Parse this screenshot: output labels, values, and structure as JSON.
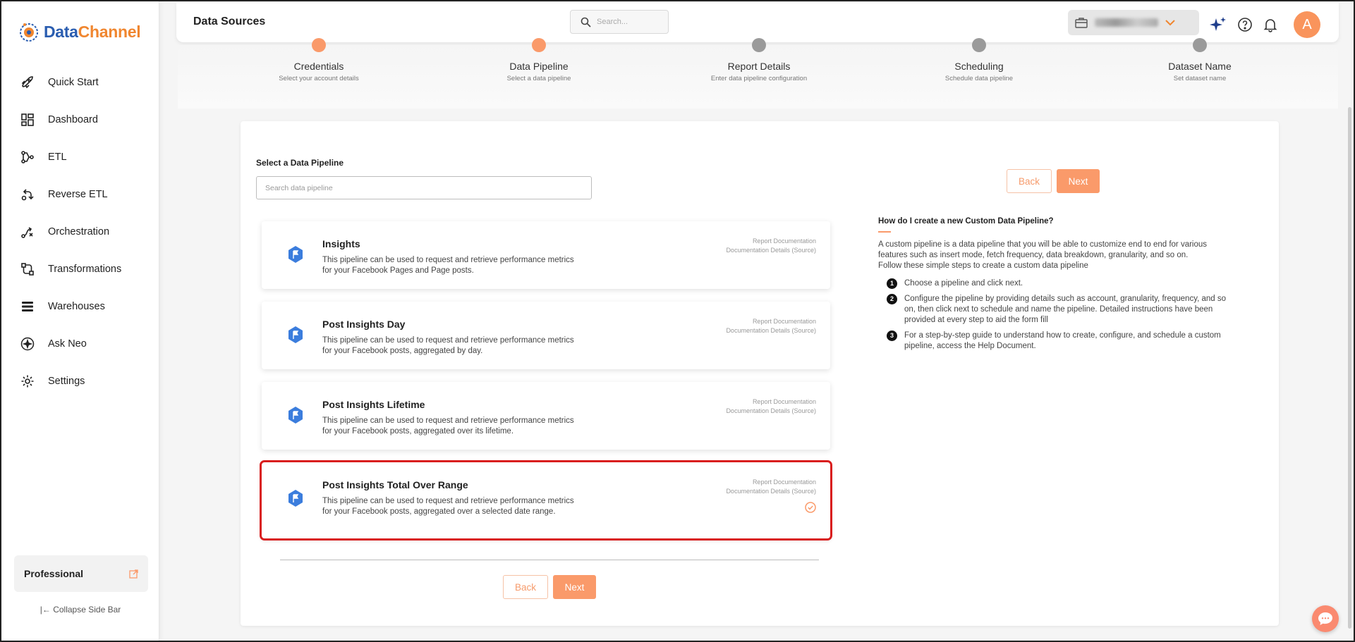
{
  "app": {
    "logo_data": "Data",
    "logo_channel": "Channel"
  },
  "sidebar": {
    "items": [
      {
        "label": "Quick Start",
        "icon": "rocket-icon"
      },
      {
        "label": "Dashboard",
        "icon": "dashboard-icon"
      },
      {
        "label": "ETL",
        "icon": "etl-icon"
      },
      {
        "label": "Reverse ETL",
        "icon": "reverse-etl-icon"
      },
      {
        "label": "Orchestration",
        "icon": "orchestration-icon"
      },
      {
        "label": "Transformations",
        "icon": "transformations-icon"
      },
      {
        "label": "Warehouses",
        "icon": "warehouses-icon"
      },
      {
        "label": "Ask Neo",
        "icon": "sparkle-icon"
      },
      {
        "label": "Settings",
        "icon": "gear-icon"
      }
    ],
    "plan": "Professional",
    "collapse_label": "Collapse Side Bar"
  },
  "header": {
    "title": "Data Sources",
    "search_placeholder": "Search..."
  },
  "stepper": [
    {
      "name": "Credentials",
      "sub": "Select your account details",
      "status": "done"
    },
    {
      "name": "Data Pipeline",
      "sub": "Select a data pipeline",
      "status": "active"
    },
    {
      "name": "Report Details",
      "sub": "Enter data pipeline configuration",
      "status": "pending"
    },
    {
      "name": "Scheduling",
      "sub": "Schedule data pipeline",
      "status": "pending"
    },
    {
      "name": "Dataset Name",
      "sub": "Set dataset name",
      "status": "pending"
    }
  ],
  "main": {
    "select_label": "Select a Data Pipeline",
    "search_placeholder": "Search data pipeline",
    "back_label": "Back",
    "next_label": "Next",
    "link_report": "Report Documentation",
    "link_details": "Documentation Details (Source)",
    "pipelines": [
      {
        "title": "Insights",
        "desc": "This pipeline can be used to request and retrieve performance metrics for your Facebook Pages and Page posts.",
        "selected": false
      },
      {
        "title": "Post Insights Day",
        "desc": "This pipeline can be used to request and retrieve performance metrics for your Facebook posts, aggregated by day.",
        "selected": false
      },
      {
        "title": "Post Insights Lifetime",
        "desc": "This pipeline can be used to request and retrieve performance metrics for your Facebook posts, aggregated over its lifetime.",
        "selected": false
      },
      {
        "title": "Post Insights Total Over Range",
        "desc": "This pipeline can be used to request and retrieve performance metrics for your Facebook posts, aggregated over a selected date range.",
        "selected": true
      }
    ]
  },
  "help": {
    "title": "How do I create a new Custom Data Pipeline?",
    "para1": "A custom pipeline is a data pipeline that you will be able to customize end to end for various features such as insert mode, fetch frequency, data breakdown, granularity, and so on.",
    "para2": "Follow these simple steps to create a custom data pipeline",
    "steps": [
      {
        "n": "1",
        "text": "Choose a pipeline and click next."
      },
      {
        "n": "2",
        "text": "Configure the pipeline by providing details such as account, granularity, frequency, and so on, then click next to schedule and name the pipeline. Detailed instructions have been provided at every step to aid the form fill"
      },
      {
        "n": "3",
        "text": "For a step-by-step guide to understand how to create, configure, and schedule a custom pipeline, access the Help Document."
      }
    ]
  },
  "colors": {
    "accent": "#fa9a6a",
    "brand_blue": "#2a5db0",
    "selected_outline": "#d91e1e",
    "facebook_blue": "#3b7ddd"
  }
}
